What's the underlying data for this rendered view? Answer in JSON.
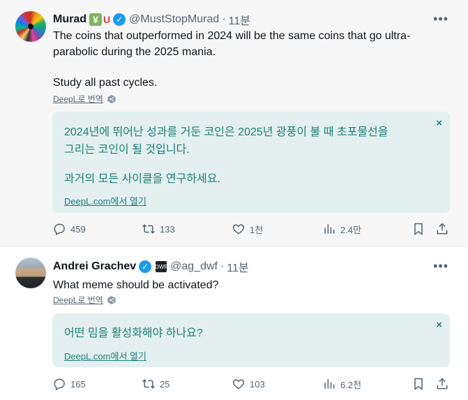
{
  "tweets": [
    {
      "author": {
        "name": "Murad",
        "emoji_1": "¥",
        "emoji_2": "U",
        "handle": "@MustStopMurad",
        "separator": "·",
        "time": "11분"
      },
      "text_line_1": "The coins that outperformed in 2024 will be the same coins that go ultra-",
      "text_line_2": "parabolic during the 2025 mania.",
      "text_line_3": "Study all past cycles.",
      "translate_label": "DeepL로 번역",
      "translation": {
        "line_1": "2024년에 뛰어난 성과를 거둔 코인은 2025년 광풍이 불 때 초포물선을",
        "line_2": "그리는 코인이 될 것입니다.",
        "line_3": "과거의 모든 사이클을 연구하세요.",
        "open_link": "DeepL.com에서 열기",
        "close": "×"
      },
      "actions": {
        "replies": "459",
        "retweets": "133",
        "likes": "1천",
        "views": "2.4만"
      }
    },
    {
      "author": {
        "name": "Andrei Grachev",
        "org_badge": "DWF",
        "handle": "@ag_dwf",
        "separator": "·",
        "time": "11분"
      },
      "text_line_1": "What meme should be activated?",
      "translate_label": "DeepL로 번역",
      "translation": {
        "line_1": "어떤 밈을 활성화해야 하나요?",
        "open_link": "DeepL.com에서 열기",
        "close": "×"
      },
      "actions": {
        "replies": "165",
        "retweets": "25",
        "likes": "103",
        "views": "6.2천"
      }
    }
  ],
  "icons": {
    "more": "more-horizontal-icon",
    "verified": "verified-check-icon",
    "reply": "reply-icon",
    "retweet": "retweet-icon",
    "like": "heart-icon",
    "views": "bar-chart-icon",
    "bookmark": "bookmark-icon",
    "share": "share-icon",
    "deepl": "deepl-hex-icon"
  },
  "colors": {
    "accent": "#1d9bf0",
    "translation_text": "#1d7f7a",
    "translation_bg": "#e3f0ef",
    "secondary_text": "#536471"
  }
}
